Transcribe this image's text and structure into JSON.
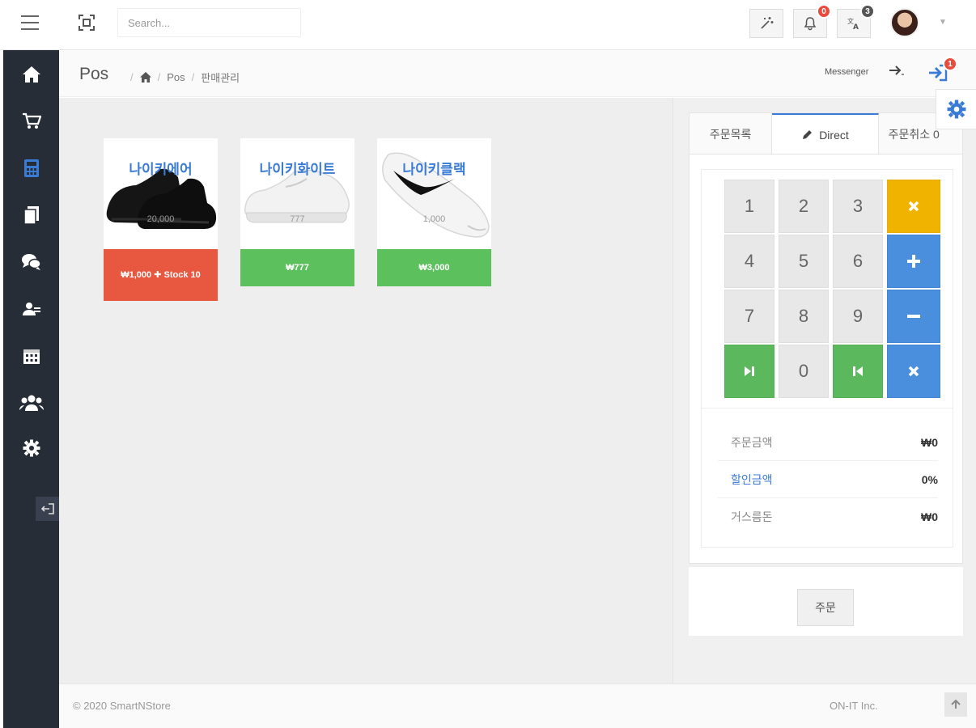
{
  "topbar": {
    "search_placeholder": "Search...",
    "notifications_count": "0",
    "translate_count": "3"
  },
  "page": {
    "title": "Pos",
    "breadcrumb": [
      "Pos",
      "판매관리"
    ]
  },
  "header_right": {
    "messenger_label": "Messenger",
    "login_badge": "1"
  },
  "products": [
    {
      "name": "나이키에어",
      "sub_price": "20,000",
      "bar_text": "₩1,000 ✚ Stock 10",
      "bar_color": "#e8573f"
    },
    {
      "name": "나이키화이트",
      "sub_price": "777",
      "bar_text": "₩777",
      "bar_color": "#5cc05c"
    },
    {
      "name": "나이키클랙",
      "sub_price": "1,000",
      "bar_text": "₩3,000",
      "bar_color": "#5cc05c"
    }
  ],
  "tabs": {
    "order_list": "주문목록",
    "direct": "Direct",
    "order_cancel": "주문취소 0"
  },
  "keypad": {
    "k1": "1",
    "k2": "2",
    "k3": "3",
    "k4": "4",
    "k5": "5",
    "k6": "6",
    "k7": "7",
    "k8": "8",
    "k9": "9",
    "k0": "0"
  },
  "summary": {
    "order_amount_label": "주문금액",
    "order_amount_value": "₩0",
    "discount_label": "할인금액",
    "discount_value": "0%",
    "change_label": "거스름돈",
    "change_value": "₩0"
  },
  "order_button": "주문",
  "footer": {
    "copyright": "© 2020 SmartNStore",
    "company": "ON-IT Inc."
  },
  "colors": {
    "sidebar_bg": "#272d37",
    "sidebar_active": "#3a7bd5",
    "accent_blue": "#4a8fde",
    "green": "#5cb85c",
    "orange": "#f0b400",
    "badge_red": "#e74c3c",
    "badge_gray": "#555555"
  }
}
